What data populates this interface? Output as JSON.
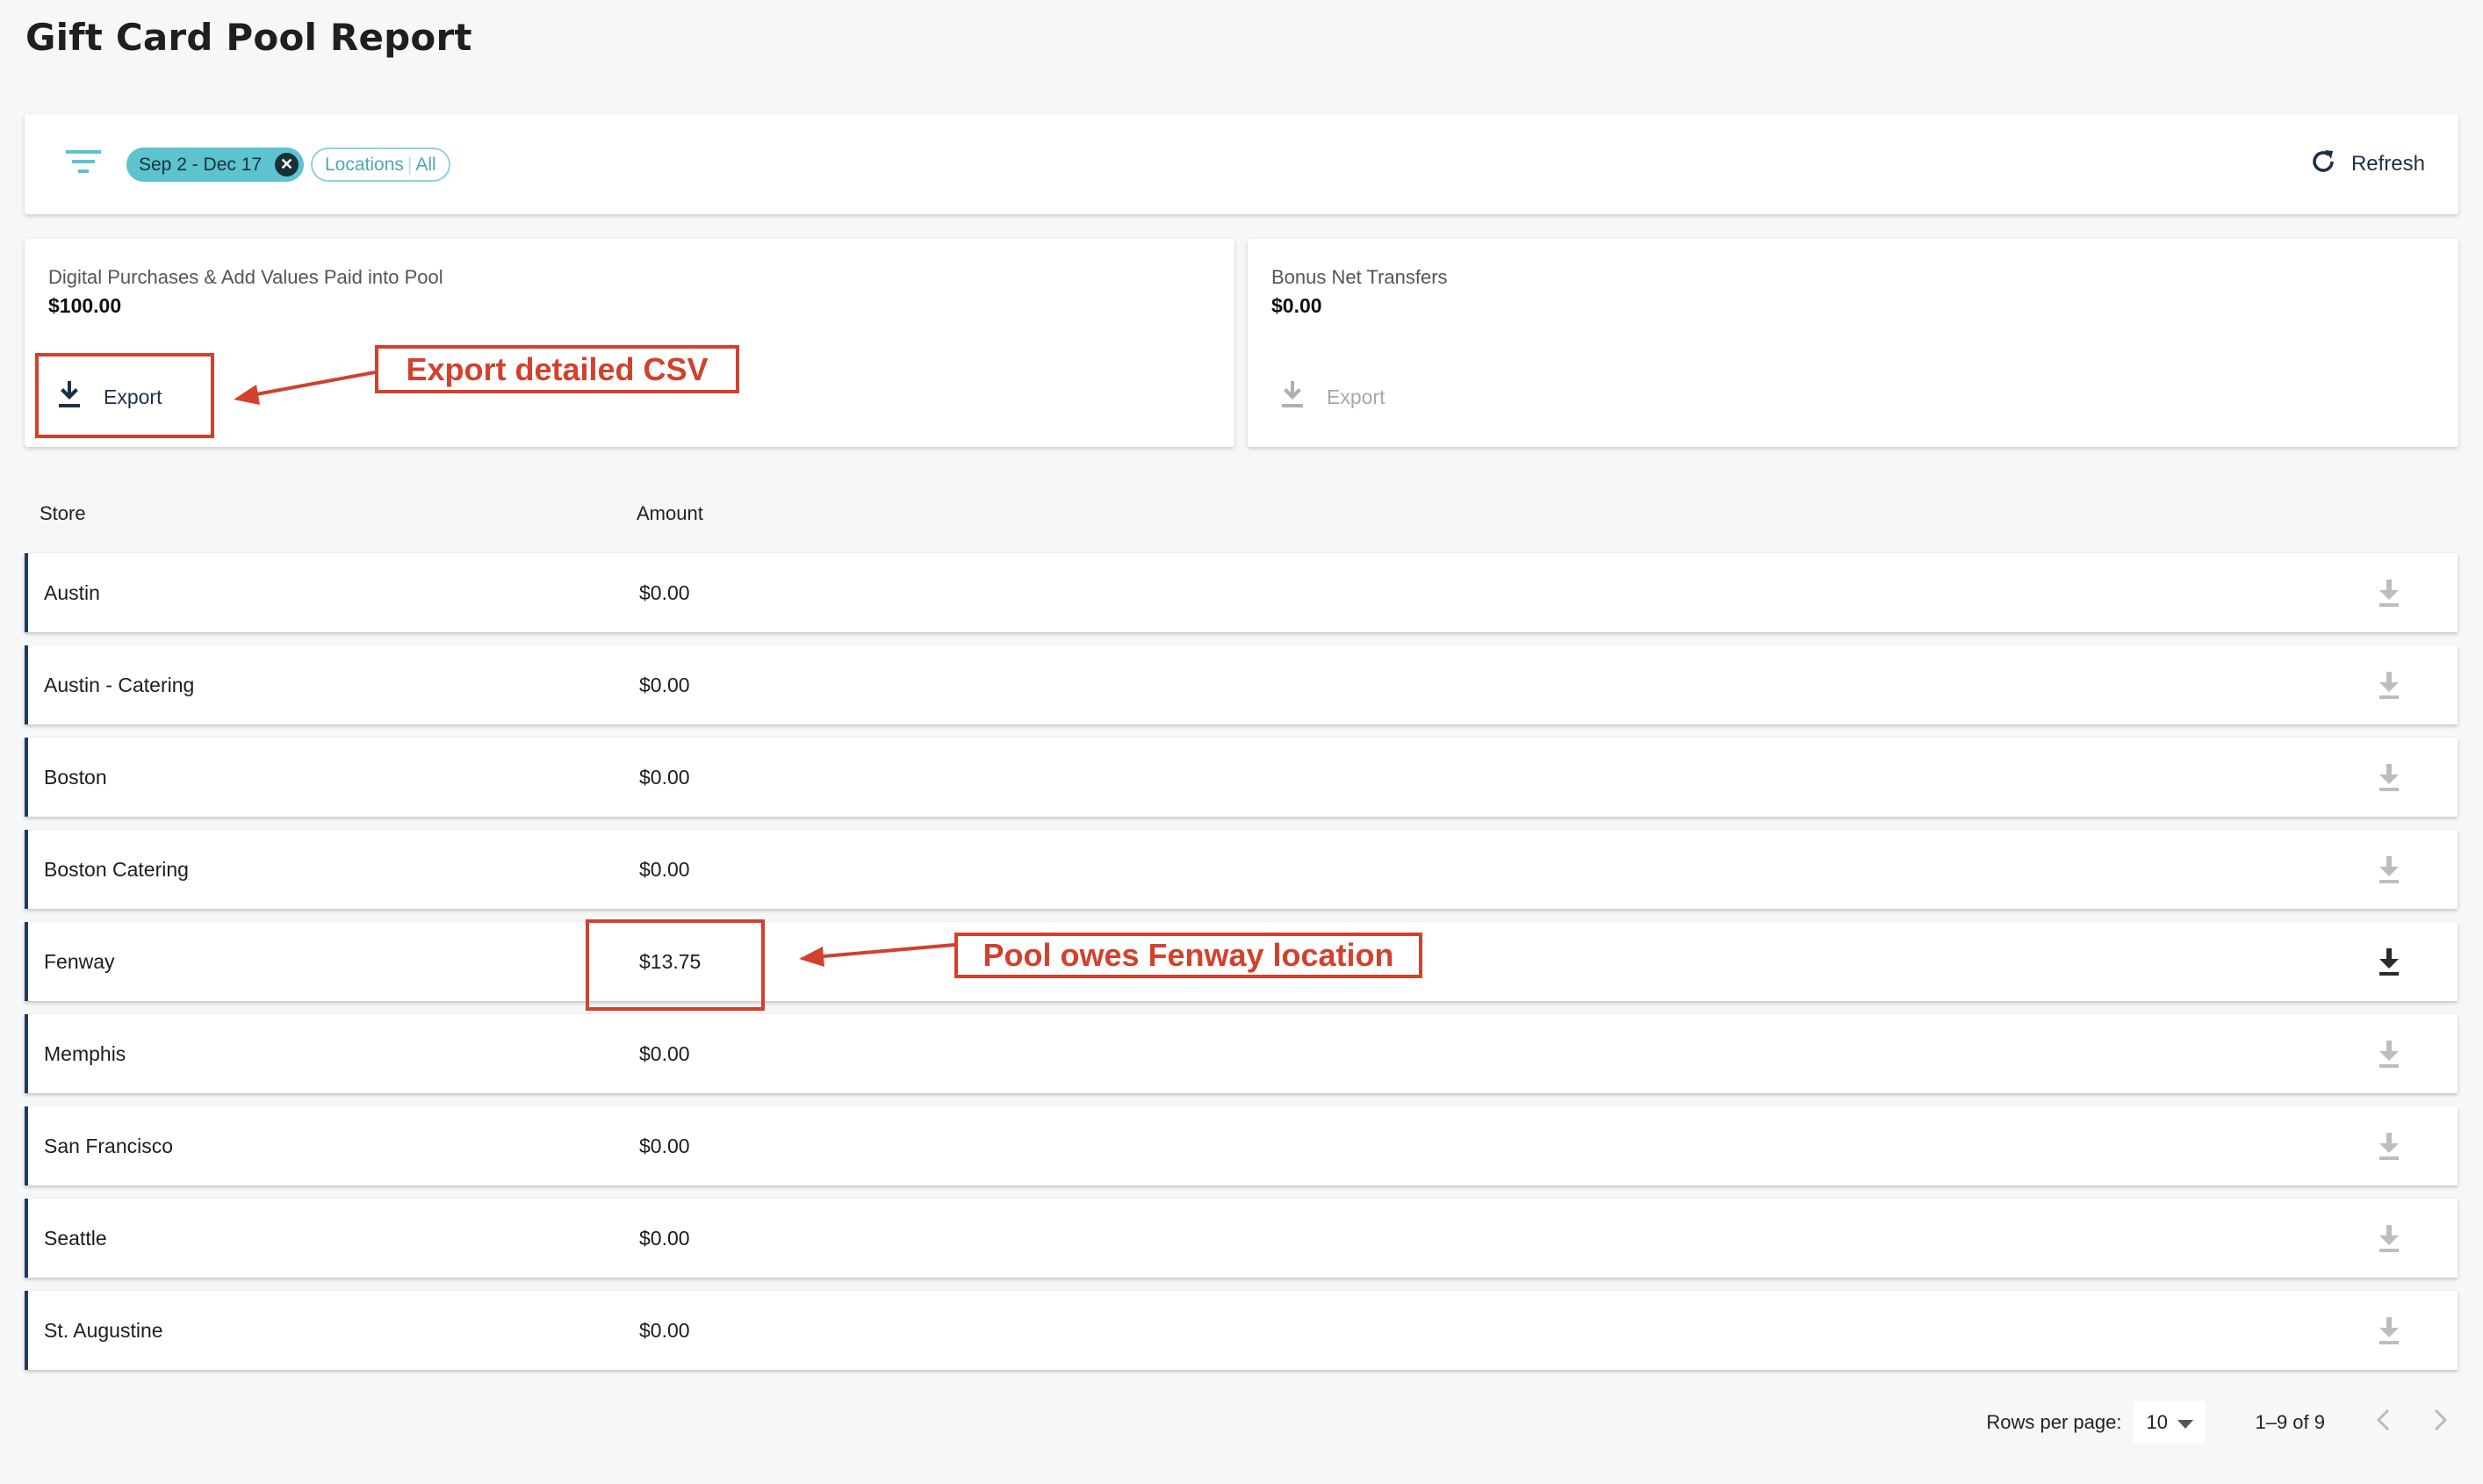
{
  "page": {
    "title": "Gift Card Pool Report"
  },
  "filters": {
    "icon": "filter-icon",
    "date_chip": "Sep 2 - Dec 17",
    "date_chip_close": "✕",
    "locations_label": "Locations",
    "locations_sep": "|",
    "locations_value": "All",
    "refresh_label": "Refresh"
  },
  "summaries": [
    {
      "label": "Digital Purchases & Add Values Paid into Pool",
      "value": "$100.00",
      "export_label": "Export",
      "export_enabled": true
    },
    {
      "label": "Bonus Net Transfers",
      "value": "$0.00",
      "export_label": "Export",
      "export_enabled": false
    }
  ],
  "table": {
    "columns": [
      "Store",
      "Amount"
    ],
    "rows": [
      {
        "store": "Austin",
        "amount": "$0.00",
        "download_active": false
      },
      {
        "store": "Austin - Catering",
        "amount": "$0.00",
        "download_active": false
      },
      {
        "store": "Boston",
        "amount": "$0.00",
        "download_active": false
      },
      {
        "store": "Boston Catering",
        "amount": "$0.00",
        "download_active": false
      },
      {
        "store": "Fenway",
        "amount": "$13.75",
        "download_active": true
      },
      {
        "store": "Memphis",
        "amount": "$0.00",
        "download_active": false
      },
      {
        "store": "San Francisco",
        "amount": "$0.00",
        "download_active": false
      },
      {
        "store": "Seattle",
        "amount": "$0.00",
        "download_active": false
      },
      {
        "store": "St. Augustine",
        "amount": "$0.00",
        "download_active": false
      }
    ]
  },
  "pagination": {
    "rows_per_page_label": "Rows per page:",
    "rows_per_page_value": "10",
    "range": "1–9 of 9"
  },
  "annotations": {
    "export": "Export detailed CSV",
    "fenway": "Pool owes Fenway location"
  },
  "colors": {
    "accent": "#5cc3cf",
    "navy": "#1e3a5c",
    "annotation": "#d2412c"
  }
}
